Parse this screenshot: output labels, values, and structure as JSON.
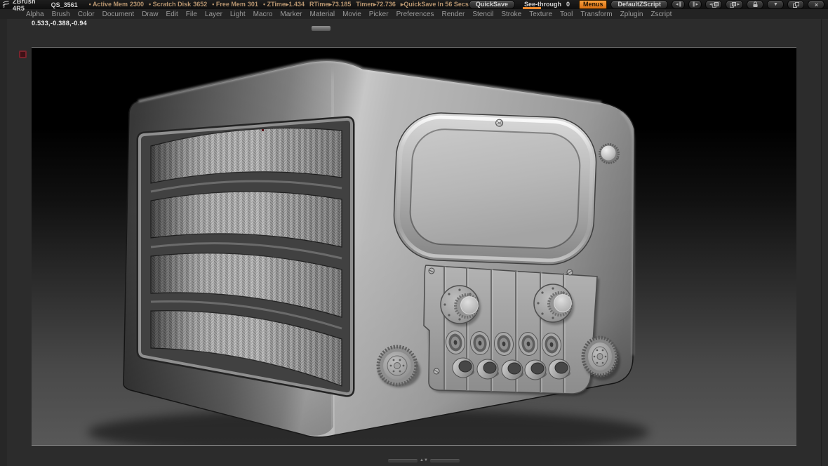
{
  "window": {
    "app_title": "ZBrush 4R5",
    "document_name": "QS_3561"
  },
  "title_bar": {
    "stats": [
      {
        "label": "Active Mem",
        "value": "2300"
      },
      {
        "label": "Scratch Disk",
        "value": "3652"
      },
      {
        "label": "Free Mem",
        "value": "301"
      },
      {
        "label": "ZTime",
        "value": "1.434"
      },
      {
        "label": "RTime",
        "value": "73.185"
      },
      {
        "label": "Timer",
        "value": "72.736"
      }
    ],
    "quicksave_countdown": "QuickSave In 56 Secs",
    "quicksave_button": "QuickSave",
    "see_through": {
      "label": "See-through",
      "value": "0"
    },
    "menus_button": "Menus",
    "zscript_button": "DefaultZScript"
  },
  "menu_bar": {
    "items": [
      "Alpha",
      "Brush",
      "Color",
      "Document",
      "Draw",
      "Edit",
      "File",
      "Layer",
      "Light",
      "Macro",
      "Marker",
      "Material",
      "Movie",
      "Picker",
      "Preferences",
      "Render",
      "Stencil",
      "Stroke",
      "Texture",
      "Tool",
      "Transform",
      "Zplugin",
      "Zscript"
    ]
  },
  "canvas": {
    "coordinates_readout": "0.533,-0.388,-0.94",
    "viewport_model": "vintage radio 3D sculpt"
  },
  "icons": {
    "tray_collapse_left": "◂",
    "tray_collapse_right": "▸",
    "tray_bars": "|||",
    "divider_arrows": "▲▼",
    "minimize": "▼",
    "close": "×"
  },
  "colors": {
    "accent_orange": "#e8862a",
    "menus_orange": "#e78224",
    "marker_red": "#7a232c",
    "ui_background": "#2c2c2c",
    "title_background": "#141414"
  }
}
